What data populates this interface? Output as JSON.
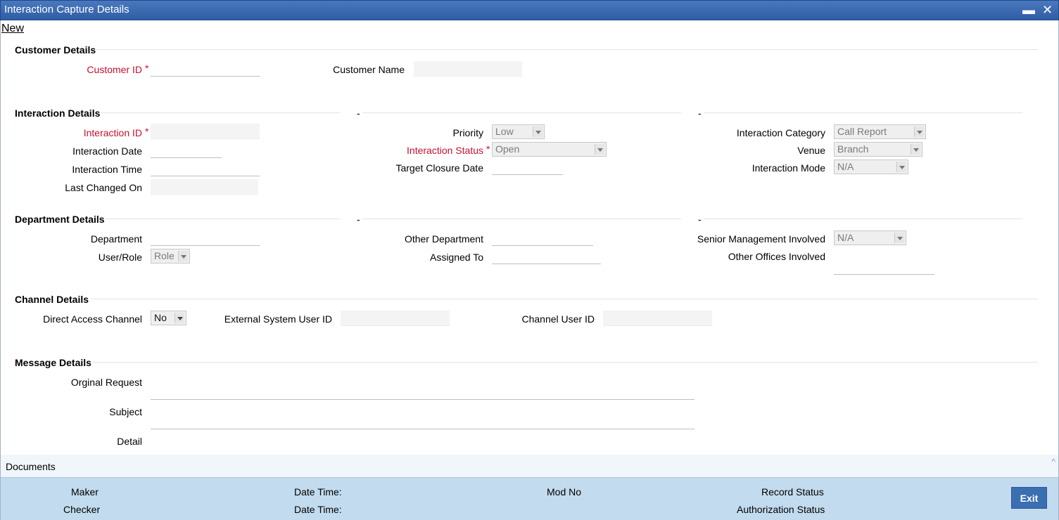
{
  "window": {
    "title": "Interaction Capture Details",
    "minimize": "▬",
    "close": "✕"
  },
  "toolbar": {
    "new_label": "New"
  },
  "customer": {
    "section": "Customer Details",
    "customer_id_label": "Customer ID",
    "customer_name_label": "Customer Name"
  },
  "interaction": {
    "section": "Interaction Details",
    "dash": "-",
    "interaction_id_label": "Interaction ID",
    "interaction_date_label": "Interaction Date",
    "interaction_time_label": "Interaction Time",
    "last_changed_label": "Last Changed On",
    "priority_label": "Priority",
    "priority_value": "Low",
    "status_label": "Interaction Status",
    "status_value": "Open",
    "target_closure_label": "Target Closure Date",
    "category_label": "Interaction Category",
    "category_value": "Call Report",
    "venue_label": "Venue",
    "venue_value": "Branch",
    "mode_label": "Interaction Mode",
    "mode_value": "N/A"
  },
  "department": {
    "section": "Department Details",
    "department_label": "Department",
    "user_role_label": "User/Role",
    "user_role_value": "Role",
    "other_department_label": "Other Department",
    "assigned_to_label": "Assigned To",
    "senior_mgmt_label": "Senior Management Involved",
    "senior_mgmt_value": "N/A",
    "other_offices_label": "Other Offices Involved"
  },
  "channel": {
    "section": "Channel Details",
    "direct_access_label": "Direct Access Channel",
    "direct_access_value": "No",
    "external_user_label": "External System User ID",
    "channel_user_label": "Channel User ID"
  },
  "message": {
    "section": "Message Details",
    "original_request_label": "Orginal Request",
    "subject_label": "Subject",
    "detail_label": "Detail"
  },
  "required_mark": "*",
  "documents": {
    "label": "Documents",
    "caret": "^"
  },
  "footer": {
    "maker": "Maker",
    "checker": "Checker",
    "date_time": "Date Time:",
    "mod_no": "Mod No",
    "record_status": "Record Status",
    "authorization_status": "Authorization Status",
    "exit": "Exit"
  },
  "colors": {
    "titlebar": "#3b6cb5",
    "required": "#c8102e",
    "footer": "#c2dbee",
    "exit_button": "#3a6fb1"
  }
}
